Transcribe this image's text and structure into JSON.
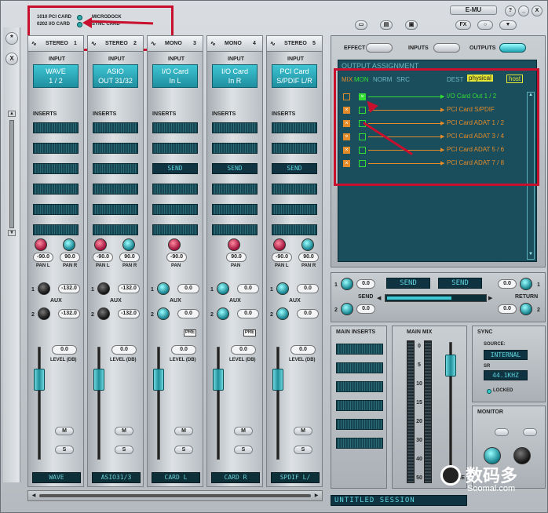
{
  "window": {
    "title": "E-MU",
    "buttons": [
      "?",
      "_",
      "X"
    ]
  },
  "cards": [
    {
      "label": "1010 PCI CARD"
    },
    {
      "label": "0202 I/O CARD"
    },
    {
      "label": "MICRODOCK"
    },
    {
      "label": "SYNC CARD"
    }
  ],
  "toolbar": {
    "effect": "EFFECT",
    "inputs": "INPUTS",
    "outputs": "OUTPUTS"
  },
  "left_tools": [
    "*",
    "X"
  ],
  "strips": [
    {
      "type": "STEREO",
      "num": "1",
      "input": [
        "WAVE",
        "1 / 2"
      ],
      "pan_l": "-90.0",
      "pan_r": "90.0",
      "pan_labels": [
        "PAN L",
        "PAN R"
      ],
      "aux": [
        "-132.0",
        "-132.0"
      ],
      "level": "0.0",
      "name": "WAVE",
      "send": "",
      "pre": ""
    },
    {
      "type": "STEREO",
      "num": "2",
      "input": [
        "ASIO",
        "OUT 31/32"
      ],
      "pan_l": "-90.0",
      "pan_r": "90.0",
      "pan_labels": [
        "PAN L",
        "PAN R"
      ],
      "aux": [
        "-132.0",
        "-132.0"
      ],
      "level": "0.0",
      "name": "ASIO31/3",
      "send": "",
      "pre": ""
    },
    {
      "type": "MONO",
      "num": "3",
      "input": [
        "I/O Card",
        "In L"
      ],
      "pan_l": "-90.0",
      "pan_r": "",
      "pan_labels": [
        "PAN",
        ""
      ],
      "aux": [
        "0.0",
        "0.0"
      ],
      "level": "0.0",
      "name": "CARD L",
      "send": "SEND",
      "pre": "PRE"
    },
    {
      "type": "MONO",
      "num": "4",
      "input": [
        "I/O Card",
        "In R"
      ],
      "pan_l": "90.0",
      "pan_r": "",
      "pan_labels": [
        "PAN",
        ""
      ],
      "aux": [
        "0.0",
        "0.0"
      ],
      "level": "0.0",
      "name": "CARD R",
      "send": "SEND",
      "pre": "PRE"
    },
    {
      "type": "STEREO",
      "num": "5",
      "input": [
        "PCI Card",
        "S/PDIF L/R"
      ],
      "pan_l": "-90.0",
      "pan_r": "90.0",
      "pan_labels": [
        "PAN L",
        "PAN R"
      ],
      "aux": [
        "0.0",
        "0.0"
      ],
      "level": "0.0",
      "name": "SPDIF L/",
      "send": "SEND",
      "pre": ""
    }
  ],
  "strip_text": {
    "input": "INPUT",
    "inserts": "INSERTS",
    "aux": "AUX",
    "level": "LEVEL (DB)",
    "m": "M",
    "s": "S",
    "aux_nums": [
      "1",
      "2"
    ]
  },
  "output_assignment": {
    "title": "OUTPUT ASSIGNMENT",
    "cols": {
      "mix": "MIX",
      "mon": "MON",
      "norm": "NORM",
      "src": "SRC",
      "dest": "DEST",
      "physical": "physical",
      "host": "host"
    },
    "routes": [
      "I/O Card Out 1 / 2",
      "PCI Card S/PDIF",
      "PCI Card ADAT 1 / 2",
      "PCI Card ADAT 3 / 4",
      "PCI Card ADAT 5 / 6",
      "PCI Card ADAT 7 / 8"
    ]
  },
  "sends": {
    "send_label": "SEND",
    "return_label": "RETURN",
    "left_vals": [
      "0.0",
      "0.0"
    ],
    "right_vals": [
      "0.0",
      "0.0"
    ],
    "nums": [
      "1",
      "2"
    ],
    "send_boxes": [
      "SEND",
      "SEND"
    ]
  },
  "main": {
    "inserts": "MAIN INSERTS",
    "mix": "MAIN MIX",
    "volume": "VOLUME",
    "scale": [
      "0",
      "5",
      "10",
      "15",
      "20",
      "30",
      "40",
      "50"
    ]
  },
  "sync": {
    "title": "SYNC",
    "source_label": "SOURCE:",
    "source": "INTERNAL",
    "sr_label": "SR",
    "sr": "44.1KHZ",
    "locked": "LOCKED"
  },
  "monitor": {
    "title": "MONITOR"
  },
  "session": "UNTITLED SESSION",
  "watermark": {
    "cn": "数码多",
    "en": "Soomal.com"
  }
}
